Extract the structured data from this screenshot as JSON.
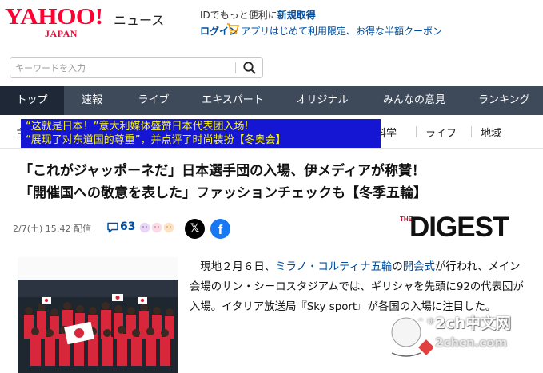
{
  "header": {
    "logo_main": "YAHOO!",
    "logo_sub": "JAPAN",
    "section_title": "ニュース",
    "promo_prefix": "IDでもっと便利に",
    "promo_link": "新規取得",
    "login": "ログイン",
    "promo2": "アプリはじめて利用限定、お得な半額クーポン"
  },
  "search": {
    "placeholder": "キーワードを入力"
  },
  "nav": {
    "items": [
      {
        "label": "トップ",
        "active": true
      },
      {
        "label": "速報"
      },
      {
        "label": "ライブ"
      },
      {
        "label": "エキスパート"
      },
      {
        "label": "オリジナル"
      },
      {
        "label": "みんなの意見"
      },
      {
        "label": "ランキング"
      }
    ]
  },
  "subnav": {
    "first_char": "主",
    "items": [
      "科学",
      "ライフ",
      "地域"
    ]
  },
  "overlay": {
    "line1": "“这就是日本！”意大利媒体盛赞日本代表团入场!",
    "line2": "“展现了对东道国的尊重”，并点评了时尚装扮【冬奥会】"
  },
  "article": {
    "headline_line1": "「これがジャッポーネだ」日本選手団の入場、伊メディアが称賛！",
    "headline_line2": "「開催国への敬意を表した」ファッションチェックも【冬季五輪】",
    "date": "2/7(土) 15:42",
    "delivery": "配信",
    "comment_count": "63",
    "source_logo_the": "THE",
    "source_logo": "DIGEST",
    "body": {
      "part1": "現地２月６日、",
      "link1": "ミラノ・コルティナ五輪",
      "part2": "の",
      "link2": "開会式",
      "part3": "が行われ、メイン会場のサン・シーロスタジアムでは、ギリシャを先頭に92の代表団が入場。イタリア放送局『Sky sport』が各国の入場に注目した。"
    }
  },
  "watermark": {
    "site": "2ch中文网",
    "url": "2chcn.com",
    "sub": "^ ゆ"
  },
  "colors": {
    "brand_red": "#ff0033",
    "link_blue": "#004fa0",
    "nav_bg": "#3e4a5a",
    "nav_active": "#1f2836",
    "overlay_bg": "#1515d4",
    "overlay_text": "#fffb00"
  }
}
